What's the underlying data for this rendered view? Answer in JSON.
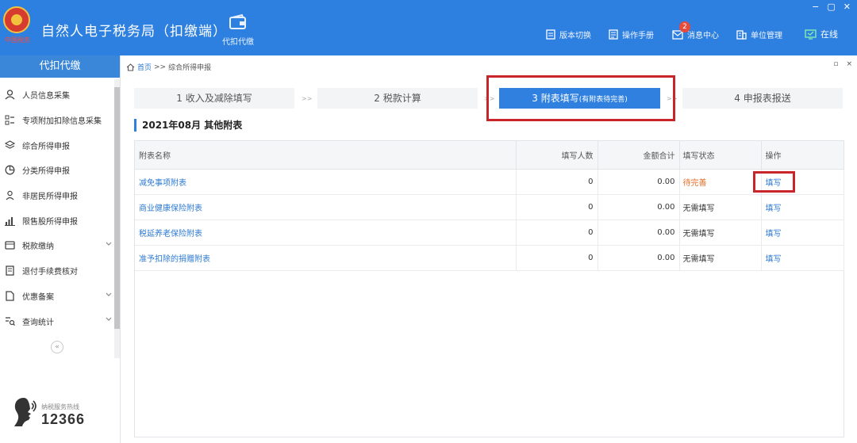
{
  "header": {
    "emblem_caption": "中国税务",
    "app_title": "自然人电子税务局（扣缴端）",
    "daikou_label": "代扣代缴",
    "actions": [
      {
        "label": "版本切换",
        "icon": "version-switch-icon"
      },
      {
        "label": "操作手册",
        "icon": "manual-icon"
      },
      {
        "label": "消息中心",
        "icon": "message-icon",
        "badge": "2"
      },
      {
        "label": "单位管理",
        "icon": "unit-manage-icon"
      },
      {
        "label": "在线",
        "icon": "online-icon"
      }
    ],
    "window_controls": [
      "−",
      "▢",
      "✕"
    ]
  },
  "sidebar": {
    "title": "代扣代缴",
    "items": [
      {
        "label": "人员信息采集",
        "icon": "person-icon"
      },
      {
        "label": "专项附加扣除信息采集",
        "icon": "list-icon"
      },
      {
        "label": "综合所得申报",
        "icon": "layers-icon"
      },
      {
        "label": "分类所得申报",
        "icon": "pie-icon"
      },
      {
        "label": "非居民所得申报",
        "icon": "person-outline-icon"
      },
      {
        "label": "限售股所得申报",
        "icon": "bar-chart-icon"
      },
      {
        "label": "税款缴纳",
        "icon": "wallet-icon",
        "expand": true
      },
      {
        "label": "退付手续费核对",
        "icon": "document-icon"
      },
      {
        "label": "优惠备案",
        "icon": "file-icon",
        "expand": true
      },
      {
        "label": "查询统计",
        "icon": "search-list-icon",
        "expand": true
      }
    ],
    "collapse_glyph": "«",
    "hotline_label": "纳税服务热线",
    "hotline_number": "12366"
  },
  "breadcrumb": {
    "home": "首页",
    "separator": ">>",
    "current": "综合所得申报"
  },
  "tab_controls": [
    "▫",
    "×"
  ],
  "steps": [
    {
      "label": "1 收入及减除填写"
    },
    {
      "label": "2 税款计算"
    },
    {
      "label": "3 附表填写",
      "sub": "(有附表待完善)"
    },
    {
      "label": "4 申报表报送"
    }
  ],
  "step_separator": ">>",
  "section_title": "2021年08月  其他附表",
  "table": {
    "headers": [
      "附表名称",
      "填写人数",
      "金额合计",
      "填写状态",
      "操作"
    ],
    "rows": [
      {
        "name": "减免事项附表",
        "count": "0",
        "amount": "0.00",
        "status": "待完善",
        "op": "填写"
      },
      {
        "name": "商业健康保险附表",
        "count": "0",
        "amount": "0.00",
        "status": "无需填写",
        "op": "填写"
      },
      {
        "name": "税延养老保险附表",
        "count": "0",
        "amount": "0.00",
        "status": "无需填写",
        "op": "填写"
      },
      {
        "name": "准予扣除的捐赠附表",
        "count": "0",
        "amount": "0.00",
        "status": "无需填写",
        "op": "填写"
      }
    ]
  },
  "colors": {
    "header_bg": "#2d7fe0",
    "active_step": "#2f80df",
    "link": "#2e7ad1",
    "pending": "#e0702a",
    "highlight_box": "#c8262a"
  }
}
